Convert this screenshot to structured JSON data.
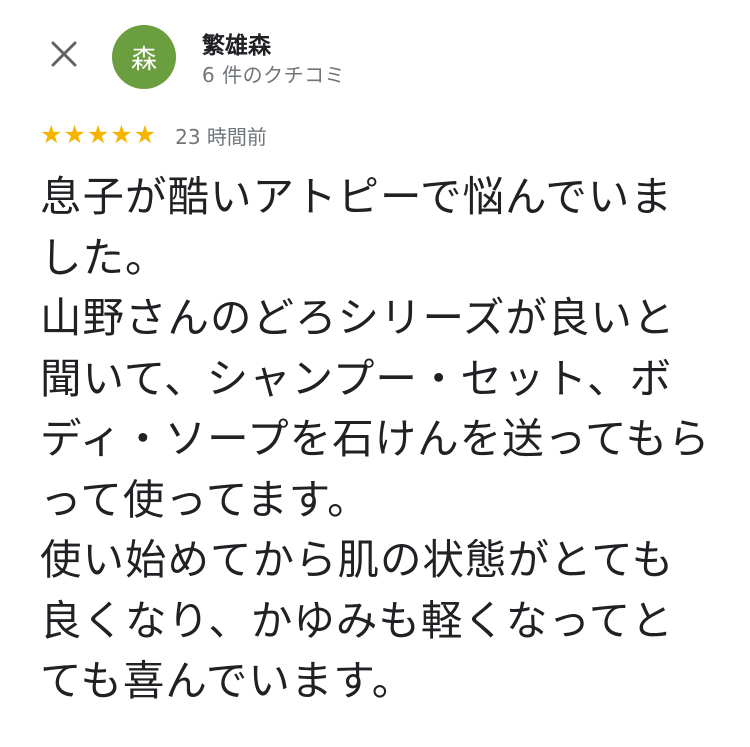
{
  "header": {
    "close_icon": "close-icon",
    "avatar": {
      "initial": "森",
      "color": "#6b9e3e"
    },
    "reviewer_name": "繁雄森",
    "review_count": "6 件のクチコミ"
  },
  "review": {
    "rating": 5,
    "max_rating": 5,
    "star_color": "#f4b400",
    "time_ago": "23 時間前",
    "text": "息子が酷いアトピーで悩んでいました。\n山野さんのどろシリーズが良いと聞いて、シャンプー・セット、ボディ・ソープを石けんを送ってもらって使ってます。\n使い始めてから肌の状態がとても良くなり、かゆみも軽くなってとても喜んでいます。"
  }
}
